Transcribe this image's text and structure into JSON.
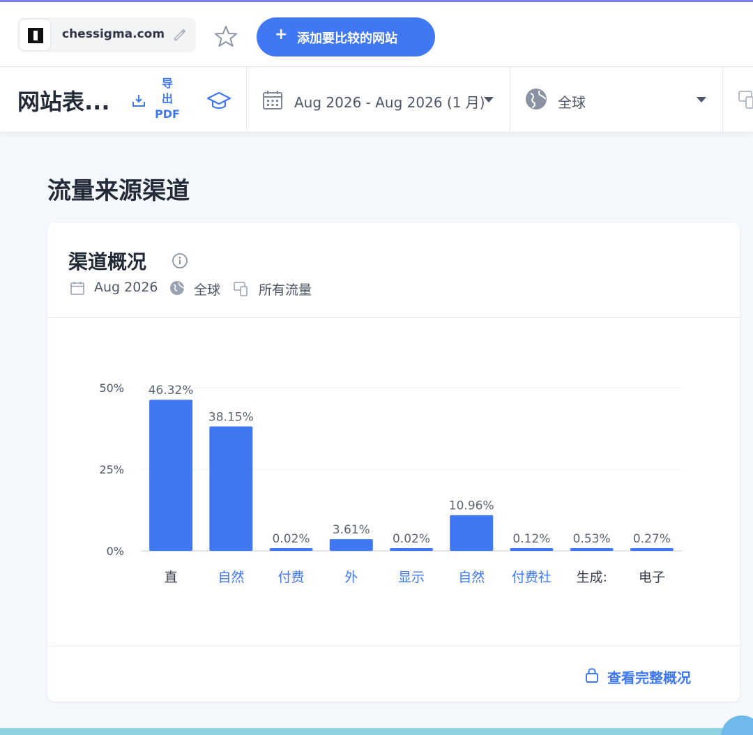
{
  "topbar": {
    "site": "chessigma.com",
    "add_compare_label": "添加要比较的网站",
    "add_icon": "plus-icon"
  },
  "subbar": {
    "page_title": "网站表...",
    "export_label_line1": "导",
    "export_label_line2": "出",
    "export_label_line3": "PDF",
    "date_range": "Aug 2026 - Aug 2026 (1 月)",
    "region": "全球"
  },
  "section": {
    "title": "流量来源渠道"
  },
  "card": {
    "title": "渠道概况",
    "meta_date": "Aug 2026",
    "meta_region": "全球",
    "meta_traffic": "所有流量",
    "full_link": "查看完整概况"
  },
  "colors": {
    "accent": "#3f78f2",
    "bar": "#3f78f2",
    "text": "#2a3040"
  },
  "chart_data": {
    "type": "bar",
    "categories": [
      "直",
      "自然",
      "付费",
      "外",
      "显示",
      "自然",
      "付费社",
      "生成:",
      "电子"
    ],
    "category_colors": [
      "#3a4150",
      "#3f78f2",
      "#3f78f2",
      "#3f78f2",
      "#3f78f2",
      "#3f78f2",
      "#3f78f2",
      "#3a4150",
      "#3a4150"
    ],
    "values": [
      46.32,
      38.15,
      0.02,
      3.61,
      0.02,
      10.96,
      0.12,
      0.53,
      0.27
    ],
    "labels": [
      "46.32%",
      "38.15%",
      "0.02%",
      "3.61%",
      "0.02%",
      "10.96%",
      "0.12%",
      "0.53%",
      "0.27%"
    ],
    "yticks": [
      "0%",
      "25%",
      "50%"
    ],
    "ytick_values": [
      0,
      25,
      50
    ],
    "ylim": [
      0,
      50
    ],
    "grid": true,
    "xlabel": "",
    "ylabel": ""
  }
}
